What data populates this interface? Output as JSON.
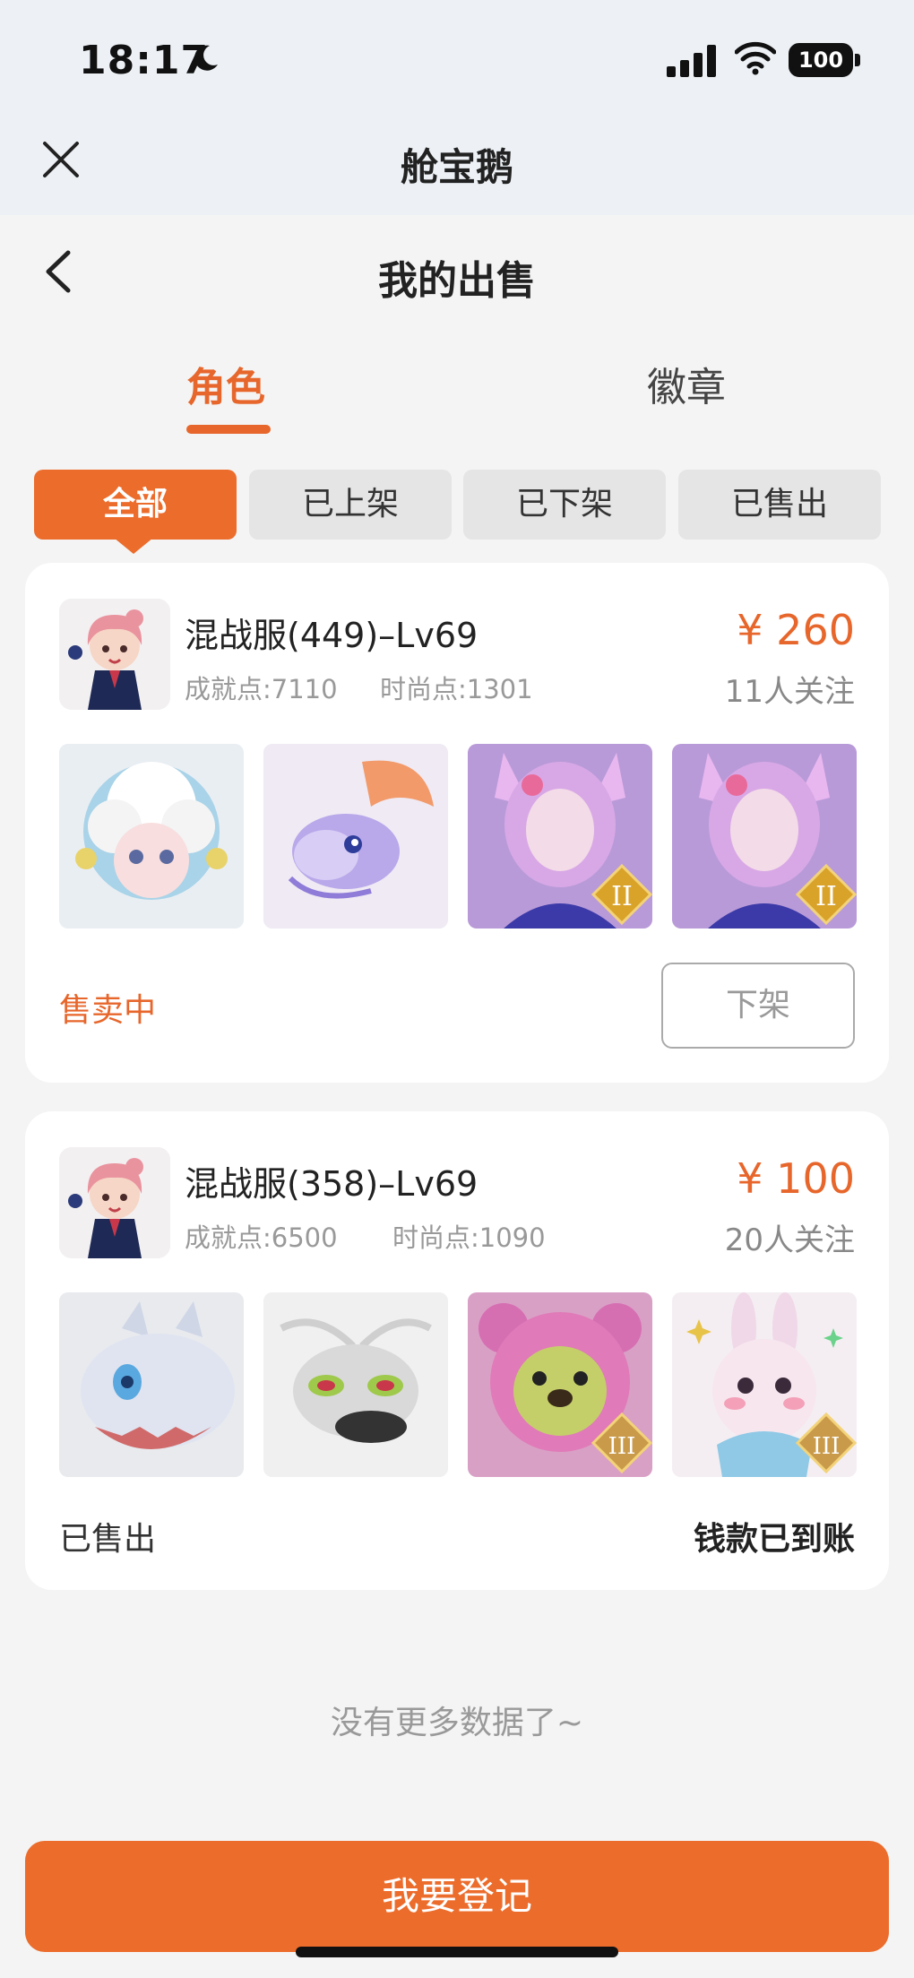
{
  "status_bar": {
    "time": "18:17",
    "battery": "100",
    "icons": [
      "moon-icon",
      "cellular-signal-icon",
      "wifi-icon",
      "battery-icon"
    ]
  },
  "app_bar": {
    "title": "舱宝鹅"
  },
  "header": {
    "title": "我的出售"
  },
  "tabs": [
    {
      "label": "角色",
      "active": true
    },
    {
      "label": "徽章",
      "active": false
    }
  ],
  "filters": [
    {
      "label": "全部",
      "active": true
    },
    {
      "label": "已上架",
      "active": false
    },
    {
      "label": "已下架",
      "active": false
    },
    {
      "label": "已售出",
      "active": false
    }
  ],
  "listings": [
    {
      "name": "混战服(449)–Lv69",
      "achievement": "成就点:7110",
      "fashion": "时尚点:1301",
      "price": "¥ 260",
      "watchers": "11人关注",
      "status": "售卖中",
      "action": "下架",
      "items": [
        "sheep-girl-character",
        "purple-dragon-pet",
        "fox-fairy-character-grade-ii",
        "fox-fairy-character-grade-ii"
      ]
    },
    {
      "name": "混战服(358)–Lv69",
      "achievement": "成就点:6500",
      "fashion": "时尚点:1090",
      "price": "¥ 100",
      "watchers": "20人关注",
      "status": "已售出",
      "note": "钱款已到账",
      "items": [
        "white-dragon-pet",
        "silver-mech-pet",
        "pink-bear-pet-grade-iii",
        "pink-rabbit-pet-grade-iii"
      ]
    }
  ],
  "footer": {
    "no_more": "没有更多数据了~",
    "register_button": "我要登记"
  },
  "colors": {
    "accent": "#ec6c2c",
    "text_primary": "#222222",
    "text_secondary": "#999999",
    "background": "#f4f4f4"
  }
}
